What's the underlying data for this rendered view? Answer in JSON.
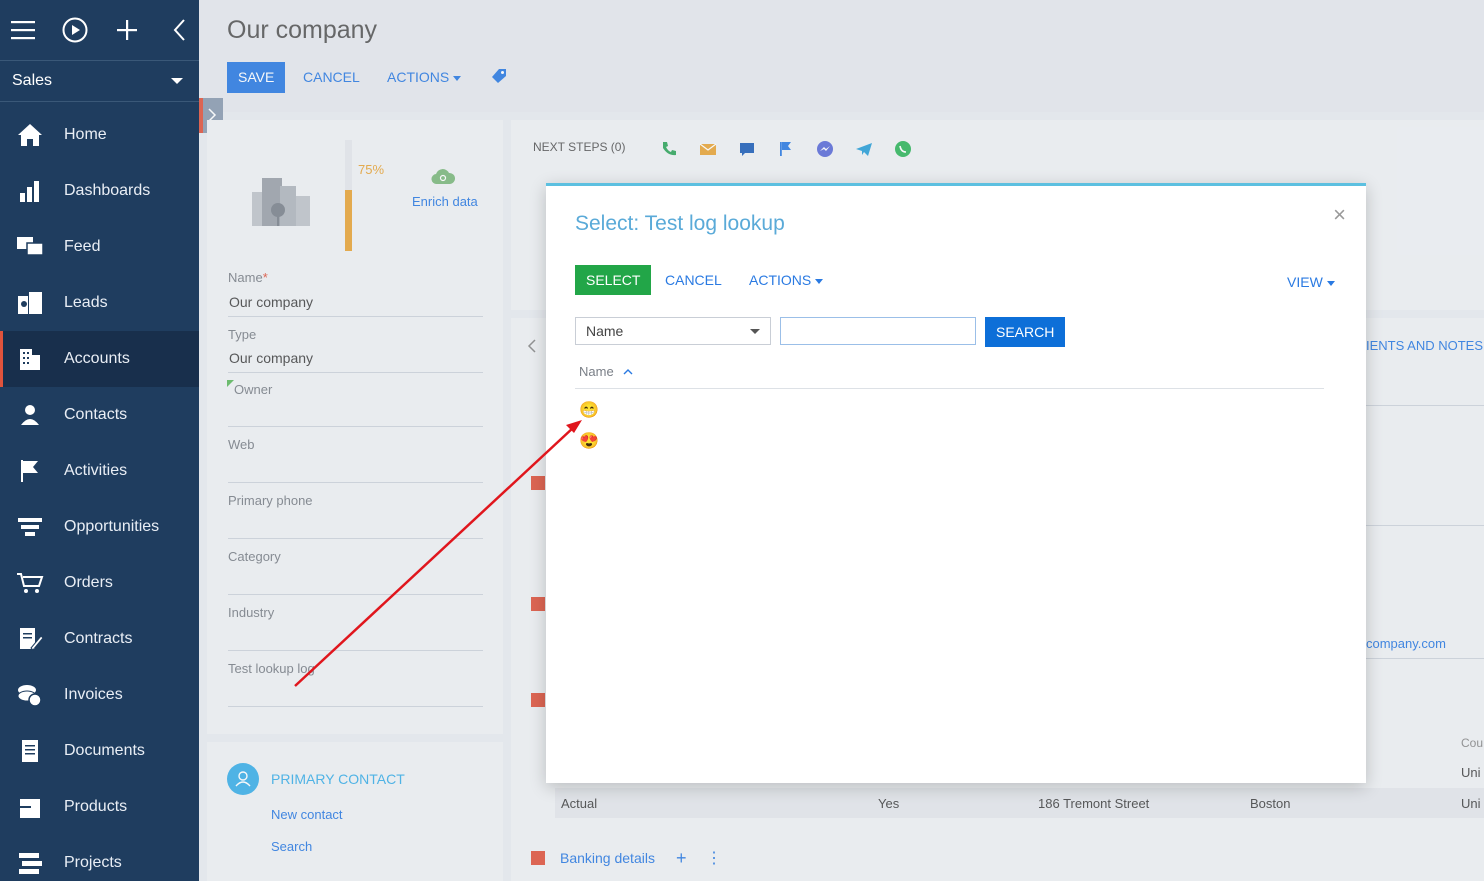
{
  "sidebar": {
    "workplace": "Sales",
    "items": [
      {
        "label": "Home",
        "icon": "home-icon"
      },
      {
        "label": "Dashboards",
        "icon": "dashboards-icon"
      },
      {
        "label": "Feed",
        "icon": "feed-icon"
      },
      {
        "label": "Leads",
        "icon": "leads-icon"
      },
      {
        "label": "Accounts",
        "icon": "accounts-icon"
      },
      {
        "label": "Contacts",
        "icon": "contacts-icon"
      },
      {
        "label": "Activities",
        "icon": "activities-icon"
      },
      {
        "label": "Opportunities",
        "icon": "opportunities-icon"
      },
      {
        "label": "Orders",
        "icon": "orders-icon"
      },
      {
        "label": "Contracts",
        "icon": "contracts-icon"
      },
      {
        "label": "Invoices",
        "icon": "invoices-icon"
      },
      {
        "label": "Documents",
        "icon": "documents-icon"
      },
      {
        "label": "Products",
        "icon": "products-icon"
      },
      {
        "label": "Projects",
        "icon": "projects-icon"
      }
    ],
    "active": "Accounts"
  },
  "header": {
    "title": "Our company",
    "save": "SAVE",
    "cancel": "CANCEL",
    "actions": "ACTIONS"
  },
  "profile": {
    "progress": "75%",
    "progress_value": 0.75,
    "enrich": "Enrich data"
  },
  "fields": [
    {
      "label": "Name",
      "value": "Our company",
      "required": true
    },
    {
      "label": "Type",
      "value": "Our company"
    },
    {
      "label": "Owner",
      "value": ""
    },
    {
      "label": "Web",
      "value": ""
    },
    {
      "label": "Primary phone",
      "value": ""
    },
    {
      "label": "Category",
      "value": ""
    },
    {
      "label": "Industry",
      "value": ""
    },
    {
      "label": "Test lookup log",
      "value": ""
    }
  ],
  "contact": {
    "title": "PRIMARY CONTACT",
    "new": "New contact",
    "search": "Search"
  },
  "nextsteps": {
    "label": "NEXT STEPS (0)"
  },
  "background": {
    "tab_partial": "IENTS AND NOTES",
    "email_partial": "company.com",
    "col_partial": "Cou",
    "uni1": "Uni",
    "uni2": "Uni",
    "row": {
      "type": "Actual",
      "primary": "Yes",
      "address": "186 Tremont Street",
      "city": "Boston"
    },
    "banking": "Banking details"
  },
  "modal": {
    "title": "Select: Test log lookup",
    "select": "SELECT",
    "cancel": "CANCEL",
    "actions": "ACTIONS",
    "view": "VIEW",
    "filter_column": "Name",
    "search_value": "",
    "search_button": "SEARCH",
    "column_header": "Name",
    "rows": [
      "😁",
      "😍"
    ]
  },
  "colors": {
    "sidebar": "#1f3d5f",
    "accent": "#2a7ae2",
    "select_green": "#22a648",
    "arrow": "#e0161d"
  }
}
